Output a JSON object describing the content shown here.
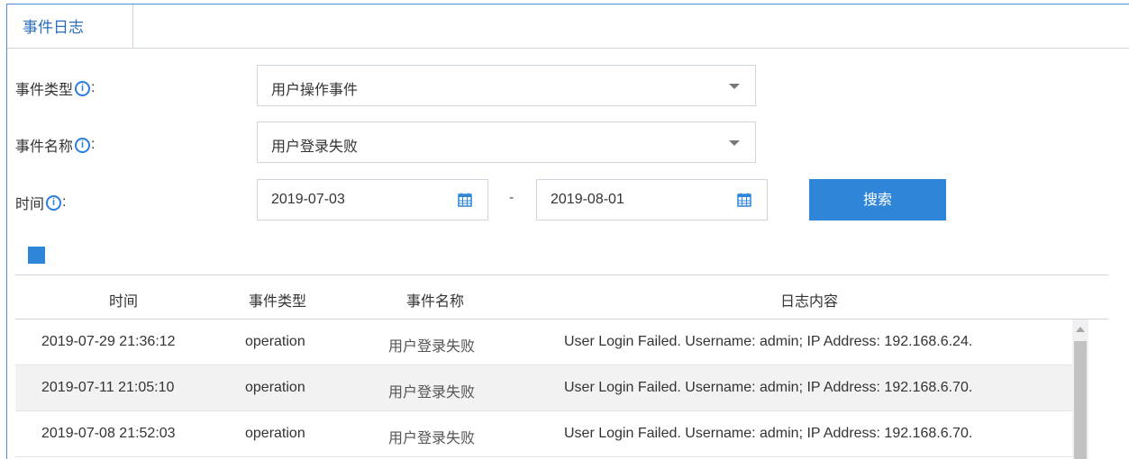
{
  "tab": {
    "label": "事件日志"
  },
  "filters": {
    "event_type": {
      "label": "事件类型",
      "suffix": ":",
      "value": "用户操作事件"
    },
    "event_name": {
      "label": "事件名称",
      "suffix": ":",
      "value": "用户登录失败"
    },
    "time": {
      "label": "时间",
      "suffix": ":",
      "start": "2019-07-03",
      "separator": "-",
      "end": "2019-08-01"
    },
    "info_glyph": "i",
    "search_label": "搜索"
  },
  "table": {
    "headers": [
      "时间",
      "事件类型",
      "事件名称",
      "日志内容"
    ],
    "rows": [
      {
        "time": "2019-07-29 21:36:12",
        "type": "operation",
        "name": "用户登录失败",
        "content": "User Login Failed. Username: admin; IP Address: 192.168.6.24."
      },
      {
        "time": "2019-07-11 21:05:10",
        "type": "operation",
        "name": "用户登录失败",
        "content": "User Login Failed. Username: admin; IP Address: 192.168.6.70."
      },
      {
        "time": "2019-07-08 21:52:03",
        "type": "operation",
        "name": "用户登录失败",
        "content": "User Login Failed. Username: admin; IP Address: 192.168.6.70."
      }
    ]
  },
  "colors": {
    "accent": "#2f86d8",
    "border": "#cfd5dc",
    "row_alt": "#f2f2f2"
  },
  "icons": [
    "info-icon",
    "calendar-icon",
    "dropdown-caret-icon"
  ]
}
